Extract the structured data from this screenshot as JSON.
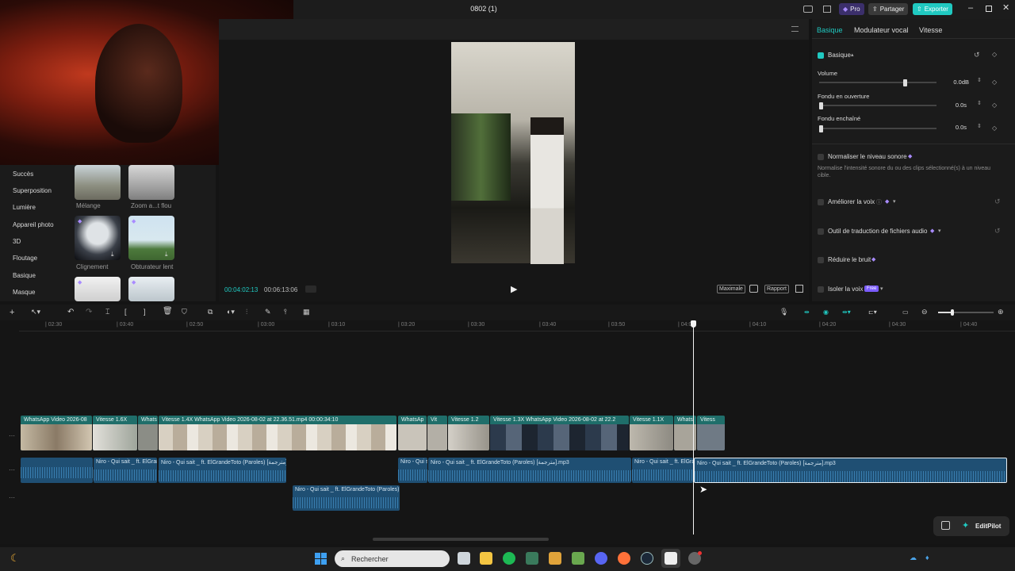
{
  "window": {
    "title": "0802 (1)"
  },
  "header": {
    "pro_label": "Pro",
    "share_label": "Partager",
    "export_label": "Exporter"
  },
  "left_panel": {
    "categories": [
      "Succès",
      "Superposition",
      "Lumière",
      "Appareil photo",
      "3D",
      "Floutage",
      "Basique",
      "Masque"
    ],
    "effects": [
      {
        "label": "Mélange"
      },
      {
        "label": "Zoom a...t flou"
      },
      {
        "label": "Clignement"
      },
      {
        "label": "Obturateur lent"
      }
    ]
  },
  "player": {
    "current_time": "00:04:02:13",
    "total_time": "00:06:13:06",
    "quality_label": "Maximale",
    "ratio_label": "Rapport"
  },
  "right_panel": {
    "tabs": [
      "Basique",
      "Modulateur vocal",
      "Vitesse"
    ],
    "section_title": "Basique",
    "volume": {
      "label": "Volume",
      "value": "0.0dB",
      "level": 0.73
    },
    "fade_in": {
      "label": "Fondu en ouverture",
      "value": "0.0s",
      "level": 0
    },
    "fade_out": {
      "label": "Fondu enchaîné",
      "value": "0.0s",
      "level": 0
    },
    "normalize": {
      "label": "Normaliser le niveau sonore",
      "desc": "Normalise l'intensité sonore du ou des clips sélectionné(s) à un niveau cible."
    },
    "enhance_voice": {
      "label": "Améliorer la voix"
    },
    "translate": {
      "label": "Outil de traduction de fichiers audio"
    },
    "reduce_noise": {
      "label": "Réduire le bruit"
    },
    "isolate_voice": {
      "label": "Isoler la voix",
      "badge": "Free"
    }
  },
  "timeline": {
    "ruler": [
      "02:30",
      "03:40",
      "02:50",
      "03:00",
      "03:10",
      "03:20",
      "03:30",
      "03:40",
      "03:50",
      "04:0",
      "04:10",
      "04:20",
      "04:30",
      "04:40"
    ],
    "video_clips": [
      {
        "label": "WhatsApp Video 2026-08"
      },
      {
        "label": "Vitesse 1.6X"
      },
      {
        "label": "Whats"
      },
      {
        "label": "Vitesse 1.4X   WhatsApp Video 2026-08-02 at 22.36.51.mp4   00:00:34:10"
      },
      {
        "label": "WhatsAp"
      },
      {
        "label": "Vit"
      },
      {
        "label": "Vitesse 1.2"
      },
      {
        "label": "Vitesse 1.3X   WhatsApp Video 2026-08-02 at 22.2"
      },
      {
        "label": "Vitesse 1.1X"
      },
      {
        "label": "Whats"
      },
      {
        "label": "Vitess"
      }
    ],
    "audio_clips": [
      {
        "label": "Niro - Qui sait _ ft. ElGran"
      },
      {
        "label": "Niro - Qui sait _ ft. ElGrandeToto (Paroles) [مترجمة].mp"
      },
      {
        "label": "Niro - Qui s"
      },
      {
        "label": "Niro - Qui sait _ ft. ElGrandeToto (Paroles) [مترجمة].mp3"
      },
      {
        "label": "Niro - Qui sait _ ft. ElGra"
      },
      {
        "label": "Niro - Qui sait _ ft. ElGrandeToto (Paroles) [مترجمة].mp3"
      }
    ],
    "audio2_clip": {
      "label": "Niro - Qui sait _ ft. ElGrandeToto (Paroles) [t"
    }
  },
  "editpilot": {
    "label": "EditPilot"
  },
  "taskbar": {
    "search_placeholder": "Rechercher"
  },
  "colors": {
    "accent": "#20c9c1",
    "pro": "#7b5cff",
    "video_clip": "#1f6e6a",
    "audio_clip": "#1f4f73"
  }
}
